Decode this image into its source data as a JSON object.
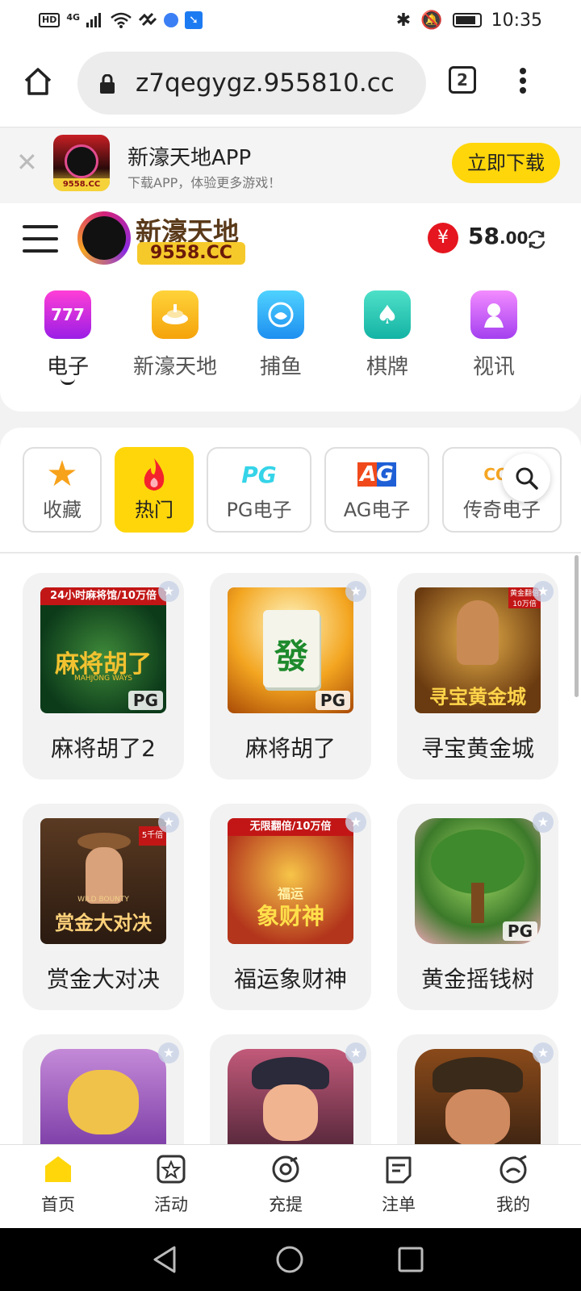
{
  "status_bar": {
    "network_badge": "HD",
    "network_type": "4G",
    "time": "10:35"
  },
  "browser": {
    "url": "z7qegygz.955810.cc",
    "tab_count": "2"
  },
  "app_banner": {
    "title": "新濠天地APP",
    "subtitle": "下载APP，体验更多游戏！",
    "download_label": "立即下载"
  },
  "site_header": {
    "logo_name": "新濠天地",
    "logo_domain": "9558.CC",
    "balance_symbol": "¥",
    "balance_int": "58",
    "balance_dec": ".00"
  },
  "categories": [
    {
      "label": "电子",
      "icon": "777",
      "active": true
    },
    {
      "label": "新濠天地",
      "icon": "live-icon"
    },
    {
      "label": "捕鱼",
      "icon": "fish-icon"
    },
    {
      "label": "棋牌",
      "icon": "spade-icon"
    },
    {
      "label": "视讯",
      "icon": "video-icon"
    }
  ],
  "filter_chips": [
    {
      "label": "收藏",
      "icon": "star-icon"
    },
    {
      "label": "热门",
      "icon": "fire-icon",
      "active": true
    },
    {
      "label": "PG电子",
      "logo": "PG"
    },
    {
      "label": "AG电子",
      "logo": "AG"
    },
    {
      "label": "传奇电子",
      "logo": "CQ9"
    }
  ],
  "games": [
    {
      "name": "麻将胡了2",
      "ribbon": "24小时麻将馆/10万倍",
      "art": "麻将胡了",
      "sub": "MAHJONG WAYS",
      "badge": "PG"
    },
    {
      "name": "麻将胡了",
      "art": "發",
      "badge": "PG"
    },
    {
      "name": "寻宝黄金城",
      "ribbon": "黄金翻倍10万倍",
      "art": "寻宝黄金城"
    },
    {
      "name": "赏金大对决",
      "ribbon": "5千倍",
      "art": "赏金大对决",
      "sub": "WILD BOUNTY"
    },
    {
      "name": "福运象财神",
      "ribbon": "无限翻倍/10万倍",
      "art": "象财神",
      "art_top": "福运"
    },
    {
      "name": "黄金摇钱树",
      "badge": "PG"
    }
  ],
  "tabs": [
    {
      "label": "首页",
      "icon": "home-icon",
      "active": true
    },
    {
      "label": "活动",
      "icon": "activity-icon"
    },
    {
      "label": "充提",
      "icon": "deposit-icon"
    },
    {
      "label": "注单",
      "icon": "orders-icon"
    },
    {
      "label": "我的",
      "icon": "profile-icon"
    }
  ],
  "colors": {
    "accent_yellow": "#ffd60a",
    "balance_red": "#e5161f"
  }
}
